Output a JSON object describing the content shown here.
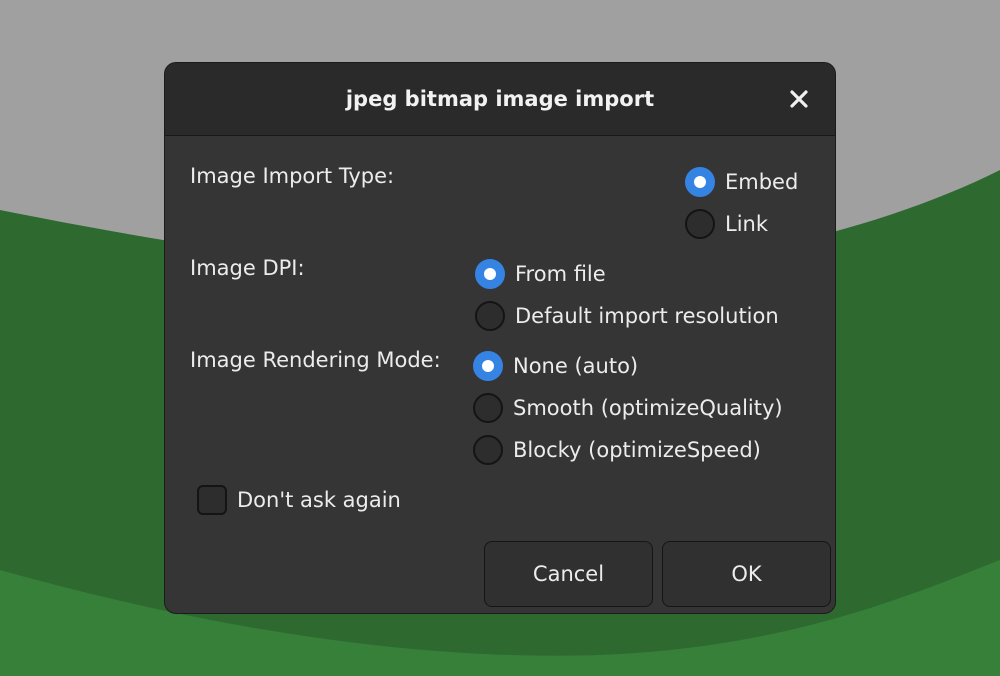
{
  "dialog": {
    "title": "jpeg bitmap image import",
    "import_type": {
      "label": "Image Import Type:",
      "options": [
        "Embed",
        "Link"
      ],
      "selected": "Embed"
    },
    "dpi": {
      "label": "Image DPI:",
      "options": [
        "From file",
        "Default import resolution"
      ],
      "selected": "From file"
    },
    "rendering_mode": {
      "label": "Image Rendering Mode:",
      "options": [
        "None (auto)",
        "Smooth (optimizeQuality)",
        "Blocky (optimizeSpeed)"
      ],
      "selected": "None (auto)"
    },
    "dont_ask": {
      "label": "Don't ask again",
      "checked": false
    },
    "buttons": {
      "cancel": "Cancel",
      "ok": "OK"
    }
  },
  "icons": {
    "close": "close-icon"
  },
  "colors": {
    "accent": "#3584e4",
    "dialog_bg": "#353535",
    "titlebar_bg": "#2a2a2a",
    "backdrop_gray": "#a0a0a0",
    "backdrop_green_dark": "#2e6a30",
    "backdrop_green_light": "#37803a"
  }
}
